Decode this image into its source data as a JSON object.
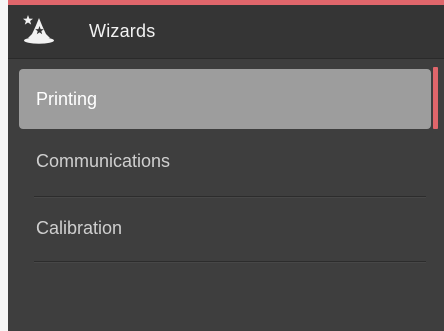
{
  "header": {
    "title": "Wizards",
    "icon": "wizard-hat-icon"
  },
  "menu": {
    "items": [
      {
        "label": "Printing",
        "selected": true
      },
      {
        "label": "Communications",
        "selected": false
      },
      {
        "label": "Calibration",
        "selected": false
      }
    ]
  },
  "colors": {
    "accent": "#e0666b",
    "background": "#3e3e3e",
    "header_background": "#353535",
    "selected_item": "#9d9d9d"
  }
}
